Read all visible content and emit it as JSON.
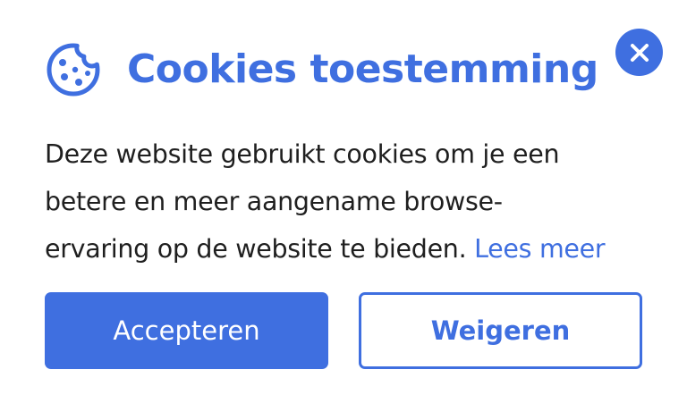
{
  "dialog": {
    "title": "Cookies toestemming",
    "icon": "cookie-icon",
    "close_icon": "close-icon",
    "message_lines": [
      "Deze website gebruikt cookies om je een",
      "betere en meer aangename browse-",
      "ervaring op de website te bieden."
    ],
    "read_more_label": "Lees meer",
    "accept_label": "Accepteren",
    "decline_label": "Weigeren"
  },
  "colors": {
    "accent": "#3f6fe0",
    "text": "#1f1f1f",
    "background": "#ffffff"
  }
}
